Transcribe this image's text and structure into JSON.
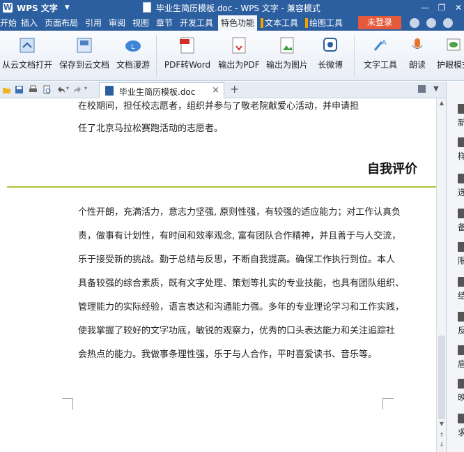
{
  "app": {
    "name": "WPS 文字",
    "logo": "W",
    "window_title": "毕业生简历模板.doc - WPS 文字 - 兼容模式"
  },
  "menu": {
    "items": [
      "开始",
      "插入",
      "页面布局",
      "引用",
      "审阅",
      "视图",
      "章节",
      "开发工具",
      "特色功能",
      "文本工具",
      "绘图工具"
    ],
    "active": "特色功能",
    "login": "未登录"
  },
  "ribbon": {
    "buttons": [
      "从云文档打开",
      "保存到云文档",
      "文档漫游",
      "PDF转Word",
      "输出为PDF",
      "输出为图片",
      "长微博",
      "文字工具",
      "朗读",
      "护眼模式"
    ]
  },
  "tabs": {
    "doc_name": "毕业生简历模板.doc",
    "close": "×",
    "add": "+"
  },
  "document": {
    "top_lines": [
      "在校期间，担任校志愿者，组织并参与了敬老院献爱心活动，并申请担",
      "任了北京马拉松赛跑活动的志愿者。"
    ],
    "section_title": "自我评价",
    "eval_lines": [
      "个性开朗，充满活力，意志力坚强, 原则性强，有较强的适应能力；对工作认真负",
      "责，做事有计划性，有时间和效率观念, 富有团队合作精神，并且善于与人交流，",
      "乐于接受新的挑战。勤于总结与反思，不断自我提高。确保工作执行到位。本人",
      "具备较强的综合素质，既有文字处理、策划等扎实的专业技能，也具有团队组织、",
      "管理能力的实际经验，语言表达和沟通能力强。多年的专业理论学习和工作实践，",
      "使我掌握了较好的文字功底，敏锐的观察力，优秀的口头表达能力和关注追踪社",
      "会热点的能力。我做事条理性强，乐于与人合作，平时喜爱读书、音乐等。"
    ]
  },
  "right_pane": {
    "items": [
      "新",
      "样",
      "选",
      "备",
      "限",
      "结",
      "反",
      "扈",
      "映",
      "求"
    ]
  },
  "colors": {
    "accent": "#2c5fa0",
    "login": "#e65a3c",
    "rule": "#a8c43c"
  }
}
